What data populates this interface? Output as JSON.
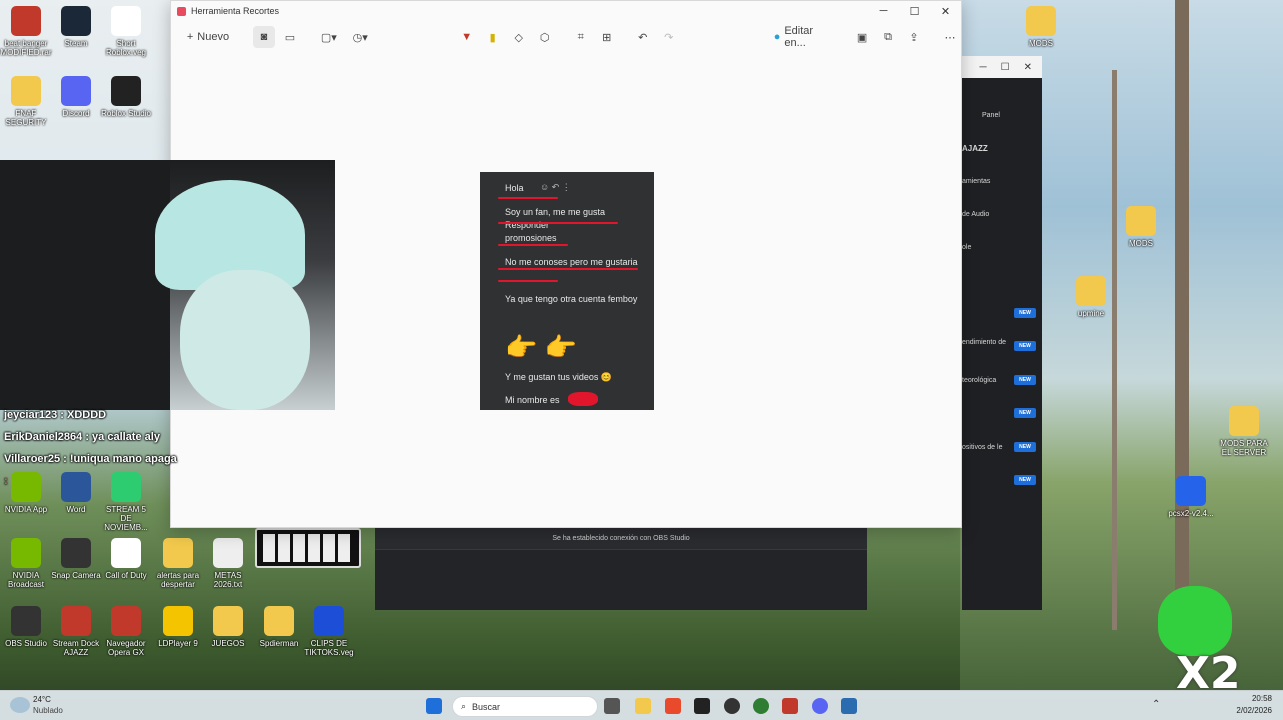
{
  "snipping_tool": {
    "title": "Herramienta Recortes",
    "new_label": "Nuevo",
    "edit_in_label": "Editar en..."
  },
  "chat_screenshot": {
    "messages": [
      {
        "text": "Hola"
      },
      {
        "text": "Soy un fan, me me gusta Responder"
      },
      {
        "text": "promosiones"
      },
      {
        "text": "No me conoses pero me gustaria"
      },
      {
        "text": "Ya que tengo otra cuenta femboy"
      },
      {
        "text": "👉 👉"
      },
      {
        "text": "Y me gustan tus videos 😊"
      },
      {
        "text": "Mi nombre es"
      }
    ]
  },
  "stream_chat": [
    {
      "user": "jeyciar123",
      "text": "jeyciar123 : XDDDD",
      "color": "#ffffff"
    },
    {
      "user": "ErikDaniel2864",
      "text": "ErikDaniel2864 : ya callate aly",
      "color": "#ffffff"
    },
    {
      "user": "Villaroer25",
      "text": "Villaroer25 : !uniqua mano apaga",
      "color": "#ffffff"
    },
    {
      "user": "",
      "text": ":",
      "color": "#ff4d4d"
    }
  ],
  "obs": {
    "status": "Se ha establecido conexión con OBS Studio"
  },
  "right_panel": {
    "tab_label": "Panel",
    "items": [
      "AJAZZ",
      "amientas",
      "de Audio",
      "ole",
      "endimiento de",
      "teorológica",
      "ositivos de le"
    ],
    "new_badge": "NEW"
  },
  "desktop_icons_left": [
    {
      "label": "beat banger MODIFIED.rar",
      "color": "#c0392b"
    },
    {
      "label": "Steam",
      "color": "#1b2838"
    },
    {
      "label": "Short Roblox.veg",
      "color": "#ffffff"
    },
    {
      "label": "FNAF SEGURITY",
      "color": "#f2c94c"
    },
    {
      "label": "Discord",
      "color": "#5865f2"
    },
    {
      "label": "Roblox Studio",
      "color": "#222222"
    },
    {
      "label": "NVIDIA App",
      "color": "#76b900"
    },
    {
      "label": "Word",
      "color": "#2b579a"
    },
    {
      "label": "STREAM 5 DE NOVIEMB...",
      "color": "#2ecc71"
    },
    {
      "label": "NVIDIA Broadcast",
      "color": "#76b900"
    },
    {
      "label": "Snap Camera",
      "color": "#333333"
    },
    {
      "label": "Call of Duty",
      "color": "#ffffff"
    },
    {
      "label": "alertas para despertar",
      "color": "#f2c94c"
    },
    {
      "label": "METAS 2026.txt",
      "color": "#eeeeee"
    },
    {
      "label": "OBS Studio",
      "color": "#333333"
    },
    {
      "label": "Stream Dock AJAZZ",
      "color": "#c0392b"
    },
    {
      "label": "Navegador Opera GX",
      "color": "#c0392b"
    },
    {
      "label": "LDPlayer 9",
      "color": "#f5c400"
    },
    {
      "label": "JUEGOS",
      "color": "#f2c94c"
    },
    {
      "label": "Spdierman",
      "color": "#f2c94c"
    },
    {
      "label": "CLIPS DE TIKTOKS.veg",
      "color": "#1d4ed8"
    }
  ],
  "desktop_icons_right": [
    {
      "label": "MODS",
      "color": "#f2c94c"
    },
    {
      "label": "MODS",
      "color": "#f2c94c"
    },
    {
      "label": "upmine",
      "color": "#f2c94c"
    },
    {
      "label": "MODS PARA EL SERVER",
      "color": "#f2c94c"
    },
    {
      "label": "pcsx2-v2.4...",
      "color": "#2563eb"
    }
  ],
  "taskbar": {
    "weather_temp": "24°C",
    "weather_desc": "Nublado",
    "search_placeholder": "Buscar",
    "time": "20:58",
    "date": "2/02/2026"
  },
  "overlay": {
    "multiplier": "X2"
  }
}
